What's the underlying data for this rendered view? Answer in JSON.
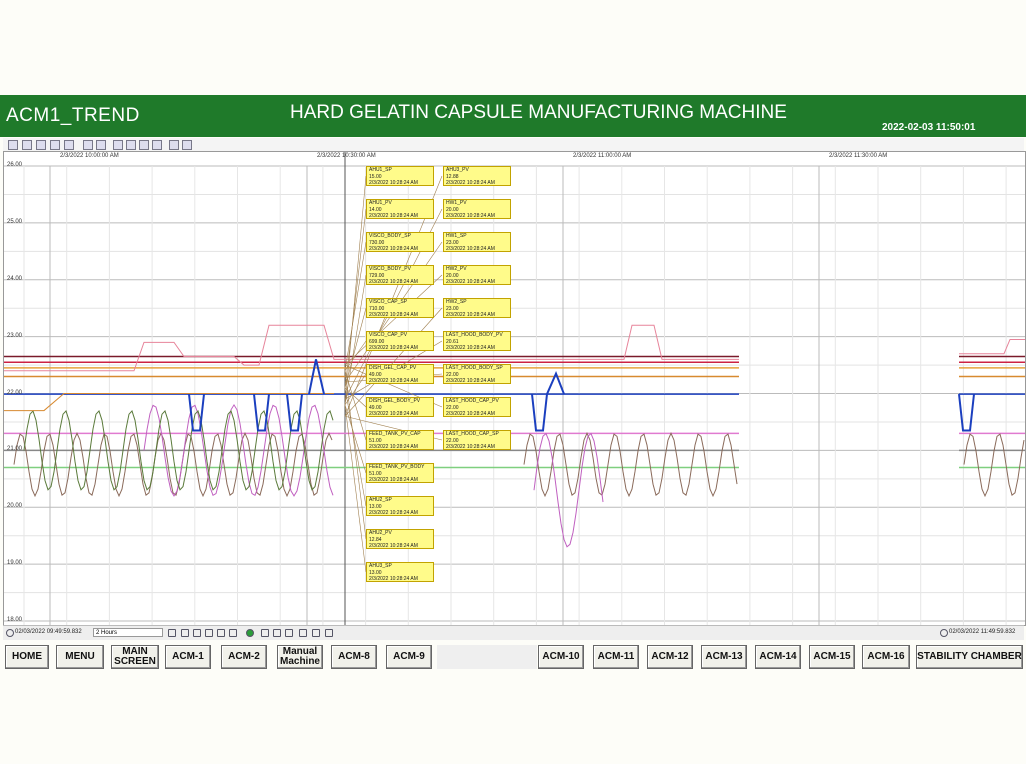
{
  "header": {
    "screen_title": "ACM1_TREND",
    "main_title": "HARD GELATIN CAPSULE MANUFACTURING MACHINE",
    "datetime": "2022-02-03 11:50:01",
    "accent_color": "#1f7a2a"
  },
  "trend": {
    "time_labels": [
      "2/3/2022 10:00:00 AM",
      "2/3/2022 10:30:00 AM",
      "2/3/2022 11:00:00 AM",
      "2/3/2022 11:30:00 AM"
    ],
    "y_labels": [
      "26.00",
      "25.00",
      "24.00",
      "23.00",
      "22.00",
      "21.00",
      "20.00",
      "19.00",
      "18.00"
    ],
    "cursor_time": "2/3/2022 10:28:24 AM",
    "tooltips_left": [
      {
        "name": "AHU1_SP",
        "value": "15.00"
      },
      {
        "name": "AHU1_PV",
        "value": "14.00"
      },
      {
        "name": "VISCO_BODY_SP",
        "value": "730.00"
      },
      {
        "name": "VISCO_BODY_PV",
        "value": "729.00"
      },
      {
        "name": "VISCO_CAP_SP",
        "value": "710.00"
      },
      {
        "name": "VISCO_CAP_PV",
        "value": "699.00"
      },
      {
        "name": "DISH_GEL_CAP_PV",
        "value": "49.00"
      },
      {
        "name": "DISH_GEL_BODY_PV",
        "value": "49.00"
      },
      {
        "name": "FEED_TANK_PV_CAP",
        "value": "51.00"
      },
      {
        "name": "FEED_TANK_PV_BODY",
        "value": "51.00"
      },
      {
        "name": "AHU2_SP",
        "value": "13.00"
      },
      {
        "name": "AHU2_PV",
        "value": "12.84"
      },
      {
        "name": "AHU3_SP",
        "value": "13.00"
      }
    ],
    "tooltips_right": [
      {
        "name": "AHU3_PV",
        "value": "12.88"
      },
      {
        "name": "HW1_PV",
        "value": "20.00"
      },
      {
        "name": "HW1_SP",
        "value": "23.00"
      },
      {
        "name": "HW2_PV",
        "value": "20.00"
      },
      {
        "name": "HW2_SP",
        "value": "23.00"
      },
      {
        "name": "LAST_HOOD_BODY_PV",
        "value": "20.61"
      },
      {
        "name": "LAST_HOOD_BODY_SP",
        "value": "22.00"
      },
      {
        "name": "LAST_HOOD_CAP_PV",
        "value": "22.00"
      },
      {
        "name": "LAST_HOOD_CAP_SP",
        "value": "22.00"
      }
    ]
  },
  "footer": {
    "start_time": "02/03/2022 09:49:59.832",
    "range": "2 Hours",
    "end_time": "02/03/2022 11:49:59.832"
  },
  "nav": {
    "buttons": [
      {
        "label": "HOME"
      },
      {
        "label": "MENU"
      },
      {
        "label": "MAIN SCREEN"
      },
      {
        "label": "ACM-1"
      },
      {
        "label": "ACM-2"
      },
      {
        "label": "Manual Machine"
      },
      {
        "label": "ACM-8"
      },
      {
        "label": "ACM-9"
      },
      {
        "label": "ACM-10"
      },
      {
        "label": "ACM-11"
      },
      {
        "label": "ACM-12"
      },
      {
        "label": "ACM-13"
      },
      {
        "label": "ACM-14"
      },
      {
        "label": "ACM-15"
      },
      {
        "label": "ACM-16"
      },
      {
        "label": "STABILITY CHAMBER"
      }
    ]
  }
}
